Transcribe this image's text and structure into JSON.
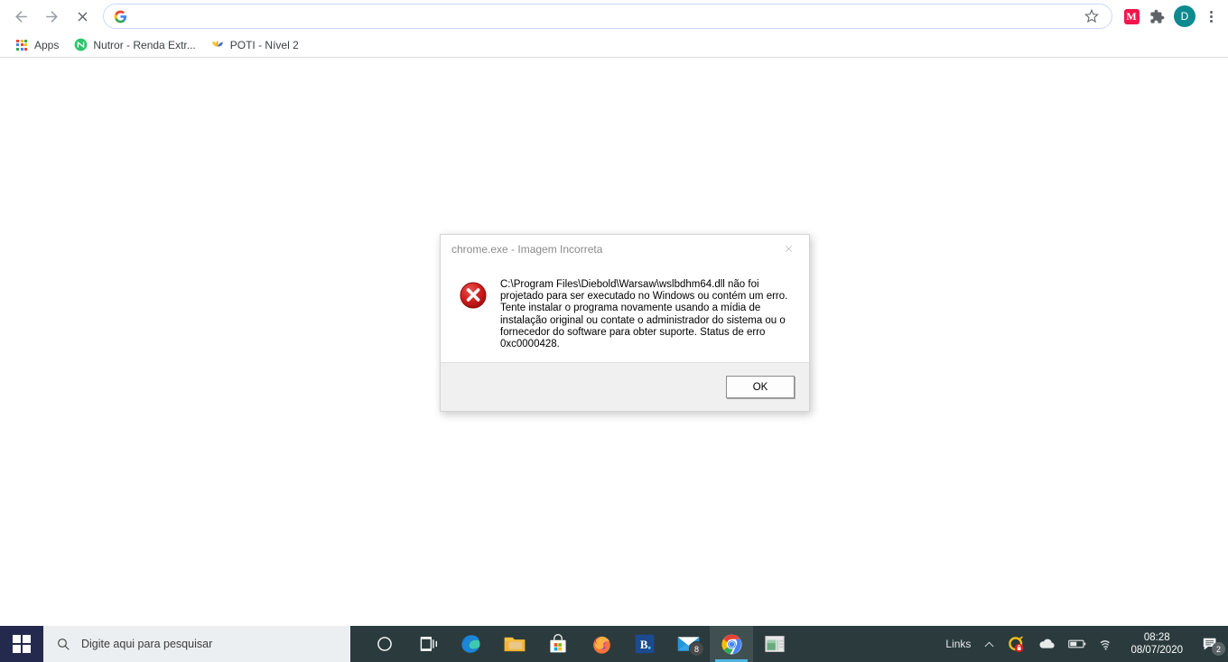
{
  "browser": {
    "nav": {
      "back_label": "Back",
      "forward_label": "Forward",
      "stop_label": "Stop"
    },
    "omnibox": {
      "value": "",
      "placeholder": "",
      "favicon": "google-g-icon",
      "bookmark_star": "star-icon"
    },
    "extensions": [
      {
        "name": "mega-extension",
        "label": "M",
        "color": "#f2164c"
      },
      {
        "name": "extensions-puzzle",
        "label": "",
        "color": "#5f6368"
      }
    ],
    "profile": {
      "initial": "D",
      "color": "#0b8a8f"
    },
    "menu_label": "Customize and control Google Chrome",
    "bookmarks": [
      {
        "name": "apps",
        "label": "Apps",
        "icon": "apps-grid-icon"
      },
      {
        "name": "nutror",
        "label": "Nutror - Renda Extr...",
        "icon": "nutror-icon"
      },
      {
        "name": "poti",
        "label": "POTI - Nível 2",
        "icon": "poti-icon"
      }
    ]
  },
  "dialog": {
    "title": "chrome.exe - Imagem Incorreta",
    "close_label": "✕",
    "icon": "error-icon",
    "message": "C:\\Program Files\\Diebold\\Warsaw\\wslbdhm64.dll não foi projetado para ser executado no Windows ou contém um erro. Tente instalar o programa novamente usando a mídia de instalação original ou contate o administrador do sistema ou o fornecedor do software para obter suporte. Status de erro 0xc0000428.",
    "ok_label": "OK"
  },
  "taskbar": {
    "start_label": "Start",
    "search_placeholder": "Digite aqui para pesquisar",
    "apps": [
      {
        "name": "cortana",
        "label": "Cortana",
        "active": false
      },
      {
        "name": "task-view",
        "label": "Task View",
        "active": false
      },
      {
        "name": "microsoft-edge",
        "label": "Microsoft Edge",
        "active": false
      },
      {
        "name": "file-explorer",
        "label": "File Explorer",
        "active": false
      },
      {
        "name": "microsoft-store",
        "label": "Microsoft Store",
        "active": false
      },
      {
        "name": "firefox",
        "label": "Firefox",
        "active": false
      },
      {
        "name": "bradesco",
        "label": "B.",
        "active": false
      },
      {
        "name": "mail",
        "label": "Mail",
        "active": false,
        "badge": "8"
      },
      {
        "name": "google-chrome",
        "label": "Google Chrome",
        "active": true
      },
      {
        "name": "spreadsheet-app",
        "label": "Spreadsheet",
        "active": false
      }
    ],
    "tray": {
      "links_label": "Links",
      "chevron": "chevron-up-icon",
      "icons": [
        "warsaw-security-icon",
        "onedrive-icon",
        "battery-icon",
        "wifi-icon"
      ],
      "time": "08:28",
      "date": "08/07/2020",
      "notifications_badge": "2"
    }
  }
}
